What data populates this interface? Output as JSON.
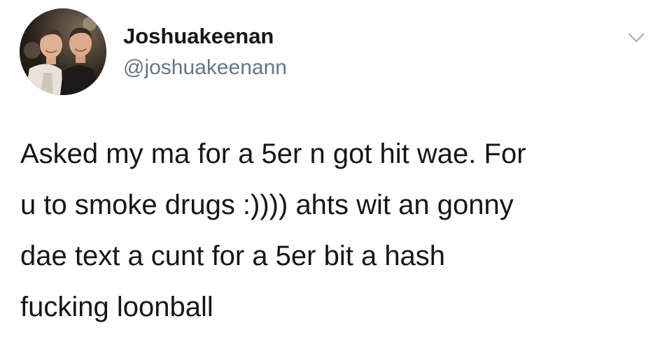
{
  "user": {
    "display_name": "Joshuakeenan",
    "handle": "@joshuakeenann"
  },
  "tweet": {
    "lines": [
      "Asked my ma for a 5er n got hit wae. For",
      "u to smoke drugs :)))) ahts wit an gonny",
      "dae text a cunt for a 5er bit a hash",
      "fucking loonball"
    ]
  },
  "icons": {
    "menu": "chevron-down-icon",
    "avatar": "profile-photo"
  },
  "colors": {
    "text_primary": "#14171a",
    "text_secondary": "#657786",
    "caret": "#aab8c2",
    "background": "#ffffff"
  }
}
